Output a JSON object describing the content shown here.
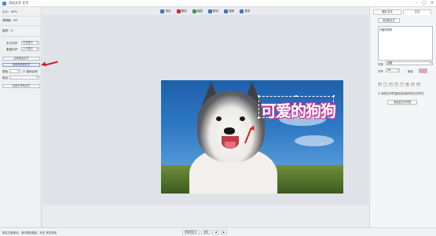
{
  "window": {
    "title": "添加文字 文字"
  },
  "left_panel": {
    "size_label": "大小：40%",
    "transparency_label": "透明度：85",
    "rotate_label": "旋转：0",
    "h_align_label": "水平对齐",
    "h_align_value": "左右居中",
    "v_align_label": "垂直对齐",
    "v_align_value": "上下居中",
    "btn_1": "应用到此文字",
    "btn_2": "应用到全部文字",
    "color_label": "颜色",
    "keep_ratio_label": "保持比例",
    "border_label": "描边",
    "btn_apply": "应用于所有文字"
  },
  "toolbar": {
    "items": [
      {
        "label": "导出",
        "color": "#3a78c9"
      },
      {
        "label": "删除",
        "color": "#d22b2b"
      },
      {
        "label": "缩放",
        "color": "#3a9a52"
      },
      {
        "label": "移动",
        "color": "#3a78c9"
      },
      {
        "label": "旋转",
        "color": "#3a78c9"
      },
      {
        "label": "更多",
        "color": "#3a78c9"
      }
    ]
  },
  "canvas": {
    "caption_text": "可爱的狗狗",
    "caption_color": "#ffffff",
    "caption_outline": "#d43a93"
  },
  "right_panel": {
    "tab_1": "图片文字",
    "tab_2": "文字",
    "add_btn": "添加新文字",
    "textarea_value": "可爱的狗狗",
    "font_label": "字体",
    "font_value": "幼圆",
    "size_label": "字号",
    "size_value": "48",
    "color_label": "颜色",
    "color_value": "#f29ac8",
    "fmt_buttons": [
      "B",
      "I",
      "U",
      "S",
      "T",
      "≡",
      "≡",
      "≡"
    ],
    "checkbox_label": "添加文字时复制当前选中的文字样式",
    "submit_btn": "添加到文字列表"
  },
  "statusbar": {
    "text": "按住左键拖动，滚动滚轮缩放，双击 清空选择",
    "zoom_btn": "按原图显示",
    "fit_btn": "适应",
    "prev": "◀",
    "next": "▶"
  },
  "annotations": {
    "arrow_color": "#d41e1e"
  }
}
